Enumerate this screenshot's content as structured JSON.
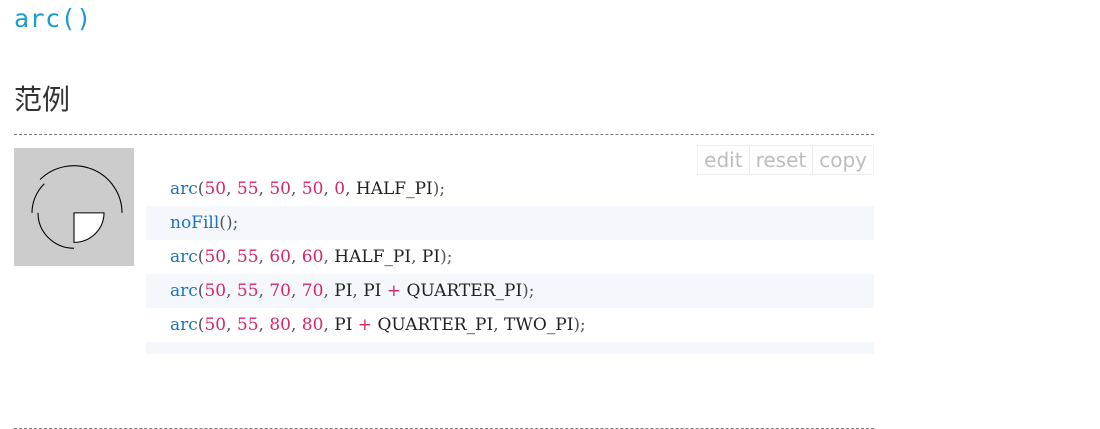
{
  "page": {
    "function_title": "arc()",
    "section_title": "范例"
  },
  "toolbar": {
    "edit_label": "edit",
    "reset_label": "reset",
    "copy_label": "copy"
  },
  "preview": {
    "background": "#cccccc",
    "stroke": "#000000",
    "fill": "#ffffff"
  },
  "code_lines": [
    {
      "fn": "arc",
      "args": [
        "50",
        "55",
        "50",
        "50",
        "0",
        "HALF_PI"
      ],
      "text": "arc(50, 55, 50, 50, 0, HALF_PI);"
    },
    {
      "fn": "noFill",
      "args": [],
      "text": "noFill();"
    },
    {
      "fn": "arc",
      "args": [
        "50",
        "55",
        "60",
        "60",
        "HALF_PI",
        "PI"
      ],
      "text": "arc(50, 55, 60, 60, HALF_PI, PI);"
    },
    {
      "fn": "arc",
      "args": [
        "50",
        "55",
        "70",
        "70",
        "PI",
        "PI + QUARTER_PI"
      ],
      "text": "arc(50, 55, 70, 70, PI, PI + QUARTER_PI);"
    },
    {
      "fn": "arc",
      "args": [
        "50",
        "55",
        "80",
        "80",
        "PI + QUARTER_PI",
        "TWO_PI"
      ],
      "text": "arc(50, 55, 80, 80, PI + QUARTER_PI, TWO_PI);"
    }
  ],
  "colors": {
    "title": "#1b9bd1",
    "function": "#1d75b3",
    "number": "#d6266a",
    "line_highlight": "#f4f7fb"
  }
}
